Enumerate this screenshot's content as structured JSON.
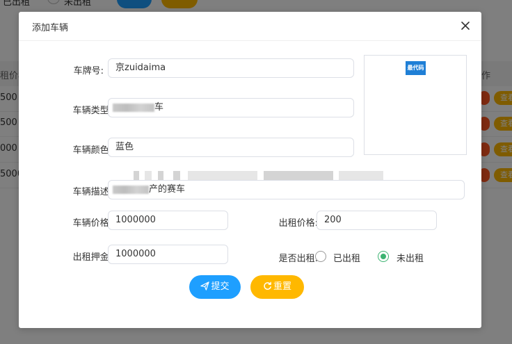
{
  "background": {
    "top_left_text": "已出租",
    "top_radio_text": "未出租",
    "column_price_head": "租价格",
    "column_action_head": "作",
    "rows": [
      "500",
      "500",
      "000",
      "5000"
    ],
    "row_action_label": "查看"
  },
  "dialog": {
    "title": "添加车辆",
    "close_icon": "close-icon",
    "fields": {
      "plate_label": "车牌号:",
      "plate_value": "京zuidaima",
      "type_label": "车辆类型:",
      "type_value_suffix": "车",
      "color_label": "车辆颜色:",
      "color_value": "蓝色",
      "desc_label": "车辆描述:",
      "desc_value_suffix": "产的赛车",
      "price_label": "车辆价格:",
      "price_value": "1000000",
      "rent_price_label": "出租价格:",
      "rent_price_value": "200",
      "deposit_label": "出租押金:",
      "deposit_value": "1000000",
      "rented_label": "是否出租:",
      "rented_option_yes": "已出租",
      "rented_option_no": "未出租",
      "rented_selected": "未出租"
    },
    "image_logo_text": "最代码",
    "buttons": {
      "submit": "提交",
      "reset": "重置"
    }
  },
  "colors": {
    "primary": "#1e9fff",
    "warning": "#ffb800",
    "radio_checked": "#3cb371",
    "danger_pill": "#ff5722"
  }
}
